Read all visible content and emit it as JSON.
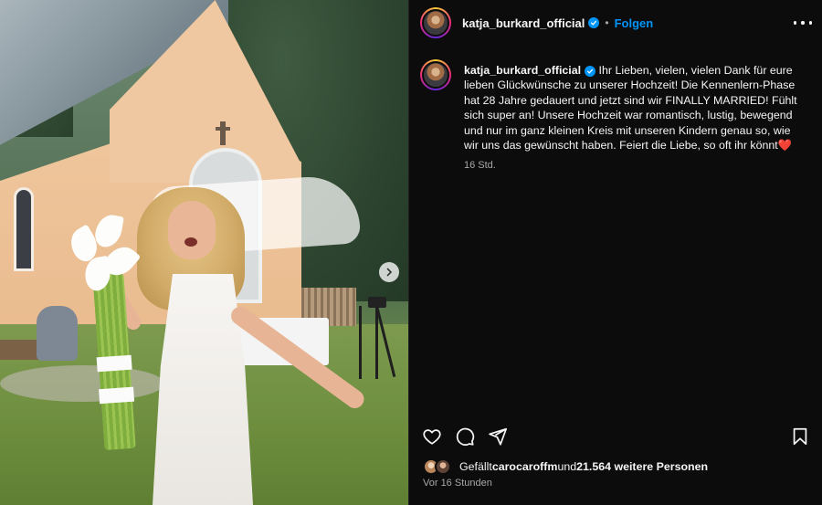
{
  "post": {
    "username": "katja_burkard_official",
    "dot": "•",
    "follow_label": "Folgen",
    "caption_text": "Ihr Lieben, vielen, vielen Dank für eure lieben Glückwünsche zu unserer Hochzeit! Die Kennenlern-Phase hat 28 Jahre gedauert und jetzt sind wir FINALLY MARRIED! Fühlt sich super an! Unsere Hochzeit war romantisch, lustig, bewegend und nur im ganz kleinen Kreis mit unseren Kindern genau so, wie wir uns das gewünscht haben. Feiert die Liebe, so oft ihr könnt",
    "caption_emoji": "❤️",
    "caption_time": "16 Std.",
    "likes_prefix": "Gefällt ",
    "likes_user": "carocaroffm",
    "likes_middle": " und ",
    "likes_count": "21.564 weitere Personen",
    "time_ago": "Vor 16 Stunden"
  },
  "icons": {
    "verified": "verified-badge-icon",
    "more": "more-options-icon",
    "like": "heart-icon",
    "comment": "comment-icon",
    "share": "send-icon",
    "save": "bookmark-icon",
    "next": "chevron-right-icon"
  },
  "colors": {
    "background": "#0c0c0c",
    "text": "#f5f5f5",
    "secondary": "#a8a8a8",
    "accent": "#0095f6",
    "heart": "#e0245e"
  }
}
